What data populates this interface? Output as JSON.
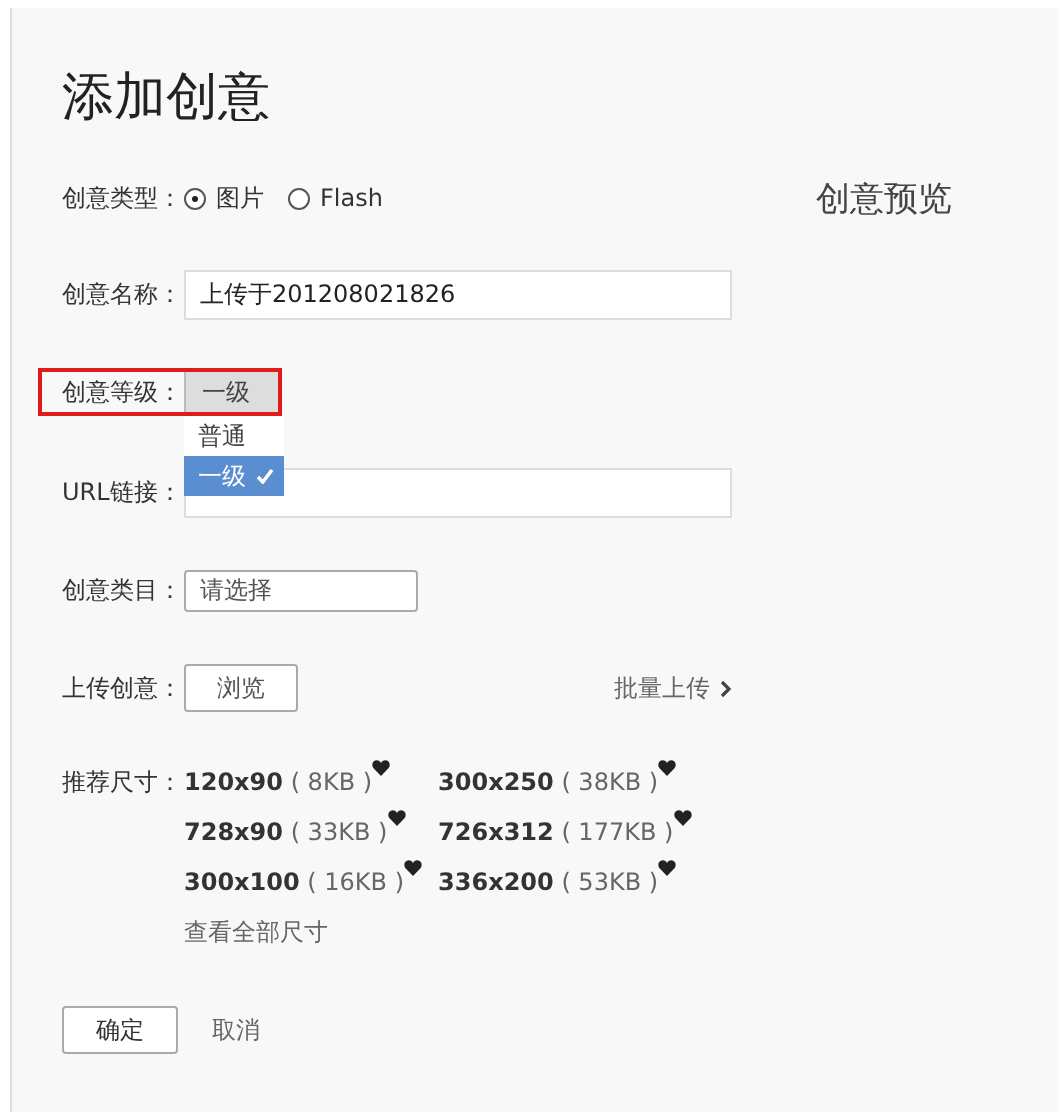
{
  "title": "添加创意",
  "preview_title": "创意预览",
  "form": {
    "type": {
      "label": "创意类型：",
      "options": [
        {
          "label": "图片",
          "selected": true
        },
        {
          "label": "Flash",
          "selected": false
        }
      ]
    },
    "name": {
      "label": "创意名称：",
      "value": "上传于201208021826"
    },
    "level": {
      "label": "创意等级：",
      "value": "一级",
      "highlighted": true,
      "expanded": true,
      "options": [
        {
          "label": "普通",
          "selected": false
        },
        {
          "label": "一级",
          "selected": true
        }
      ]
    },
    "url": {
      "label": "URL链接："
    },
    "category": {
      "label": "创意类目：",
      "value": "请选择"
    },
    "upload": {
      "label": "上传创意：",
      "button": "浏览",
      "batch_link": "批量上传"
    },
    "sizes": {
      "label": "推荐尺寸：",
      "items": [
        {
          "size": "120x90",
          "weight": "( 8KB )"
        },
        {
          "size": "300x250",
          "weight": "( 38KB )"
        },
        {
          "size": "728x90",
          "weight": "( 33KB )"
        },
        {
          "size": "726x312",
          "weight": "( 177KB )"
        },
        {
          "size": "300x100",
          "weight": "( 16KB )"
        },
        {
          "size": "336x200",
          "weight": "( 53KB )"
        }
      ],
      "view_all": "查看全部尺寸"
    }
  },
  "actions": {
    "confirm": "确定",
    "cancel": "取消"
  }
}
